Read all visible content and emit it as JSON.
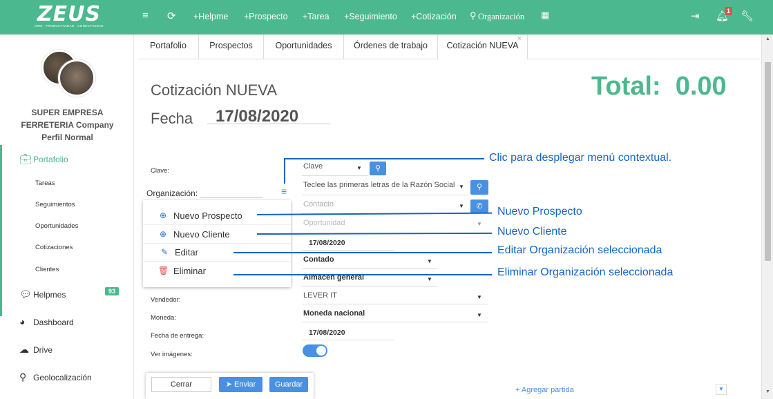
{
  "header": {
    "logo": "ZEUS",
    "logo_sub": "CRM · PRODUCTIVIDAD · CONECTIVIDAD",
    "nav": [
      "+Helpme",
      "+Prospecto",
      "+Tarea",
      "+Seguimiento",
      "+Cotización",
      "Organización"
    ],
    "notifications": "1",
    "icons": [
      "menu-icon",
      "refresh-icon",
      "search-icon",
      "calendar-icon",
      "logout-icon",
      "bell-icon",
      "wrench-icon"
    ]
  },
  "sidebar": {
    "company": "SUPER EMPRESA FERRETERIA Company",
    "profile": "Perfil Normal",
    "portafolio": "Portafolio",
    "sub_items": [
      "Tareas",
      "Seguimientos",
      "Oportunidades",
      "Cotizaciones",
      "Clientes"
    ],
    "helpmes": "Helpmes",
    "helpmes_count": "93",
    "dashboard": "Dashboard",
    "drive": "Drive",
    "geo": "Geolocalización"
  },
  "tabs": [
    "Portafolio",
    "Prospectos",
    "Oportunidades",
    "Órdenes de trabajo",
    "Cotización NUEVA"
  ],
  "form": {
    "title": "Cotización NUEVA",
    "fecha_label": "Fecha",
    "fecha": "17/08/2020",
    "total_label": "Total:",
    "total": "0.00",
    "labels": {
      "clave": "Clave:",
      "organizacion": "Organización:",
      "vendedor": "Vendedor:",
      "moneda": "Moneda:",
      "entrega": "Fecha de entrega:",
      "imagenes": "Ver imágenes:"
    },
    "clave_select": "Clave",
    "org_placeholder": "Teclee las primeras letras de la Razón Social",
    "contacto": "Contacto",
    "oportunidad": "Oportunidad",
    "fecha_field": "17/08/2020",
    "pago": "Contado",
    "almacen": "Almacen general",
    "vendedor": "LEVER IT",
    "moneda": "Moneda nacional",
    "entrega": "17/08/2020",
    "ver_imagenes": true
  },
  "menu": [
    "Nuevo Prospecto",
    "Nuevo Cliente",
    "Editar",
    "Eliminar"
  ],
  "footer": {
    "cerrar": "Cerrar",
    "enviar": "Enviar",
    "guardar": "Guardar",
    "agregar": "+ Agregar partida"
  },
  "annotations": {
    "menu": "Clic para desplegar menú contextual.",
    "prospecto": "Nuevo Prospecto",
    "cliente": "Nuevo Cliente",
    "editar": "Editar Organización seleccionada",
    "eliminar": "Eliminar Organización seleccionada"
  },
  "colors": {
    "brand": "#4cb88f",
    "accent": "#4a90e2",
    "annotation": "#1565c0",
    "danger": "#d9534f"
  }
}
